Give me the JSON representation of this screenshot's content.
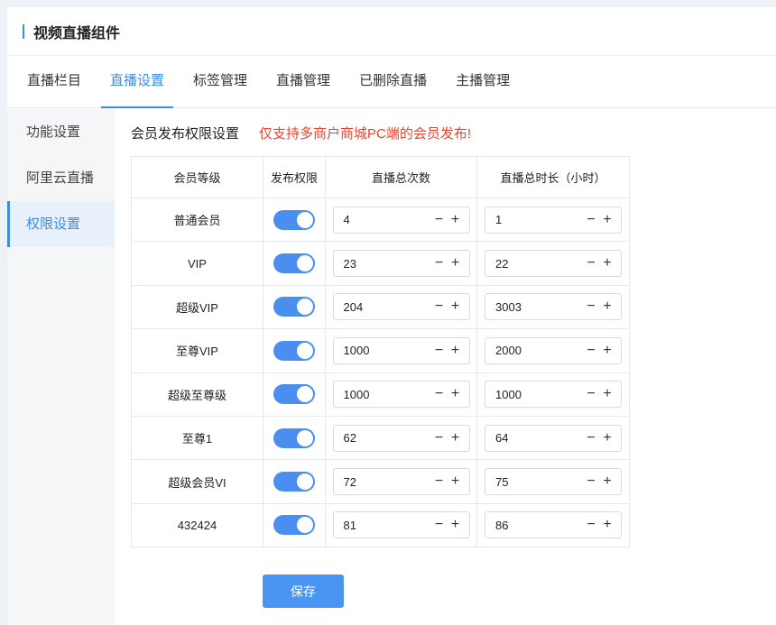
{
  "header": {
    "title": "视频直播组件"
  },
  "tabs": [
    {
      "label": "直播栏目"
    },
    {
      "label": "直播设置"
    },
    {
      "label": "标签管理"
    },
    {
      "label": "直播管理"
    },
    {
      "label": "已删除直播"
    },
    {
      "label": "主播管理"
    }
  ],
  "active_tab": "直播设置",
  "sidebar": {
    "items": [
      {
        "label": "功能设置"
      },
      {
        "label": "阿里云直播"
      },
      {
        "label": "权限设置"
      }
    ],
    "active": "权限设置"
  },
  "section": {
    "title": "会员发布权限设置",
    "note": "仅支持多商户商城PC端的会员发布!"
  },
  "table": {
    "headers": [
      "会员等级",
      "发布权限",
      "直播总次数",
      "直播总时长（小时）"
    ],
    "rows": [
      {
        "level": "普通会员",
        "enabled": true,
        "count": "4",
        "duration": "1"
      },
      {
        "level": "VIP",
        "enabled": true,
        "count": "23",
        "duration": "22"
      },
      {
        "level": "超级VIP",
        "enabled": true,
        "count": "204",
        "duration": "3003"
      },
      {
        "level": "至尊VIP",
        "enabled": true,
        "count": "1000",
        "duration": "2000"
      },
      {
        "level": "超级至尊级",
        "enabled": true,
        "count": "1000",
        "duration": "1000"
      },
      {
        "level": "至尊1",
        "enabled": true,
        "count": "62",
        "duration": "64"
      },
      {
        "level": "超级会员VI",
        "enabled": true,
        "count": "72",
        "duration": "75"
      },
      {
        "level": "432424",
        "enabled": true,
        "count": "81",
        "duration": "86"
      }
    ],
    "minus": "−",
    "plus": "+"
  },
  "save_label": "保存",
  "colors": {
    "accent": "#3a8ee6",
    "warning": "#e8432e",
    "switch_on": "#4a8ff0"
  }
}
